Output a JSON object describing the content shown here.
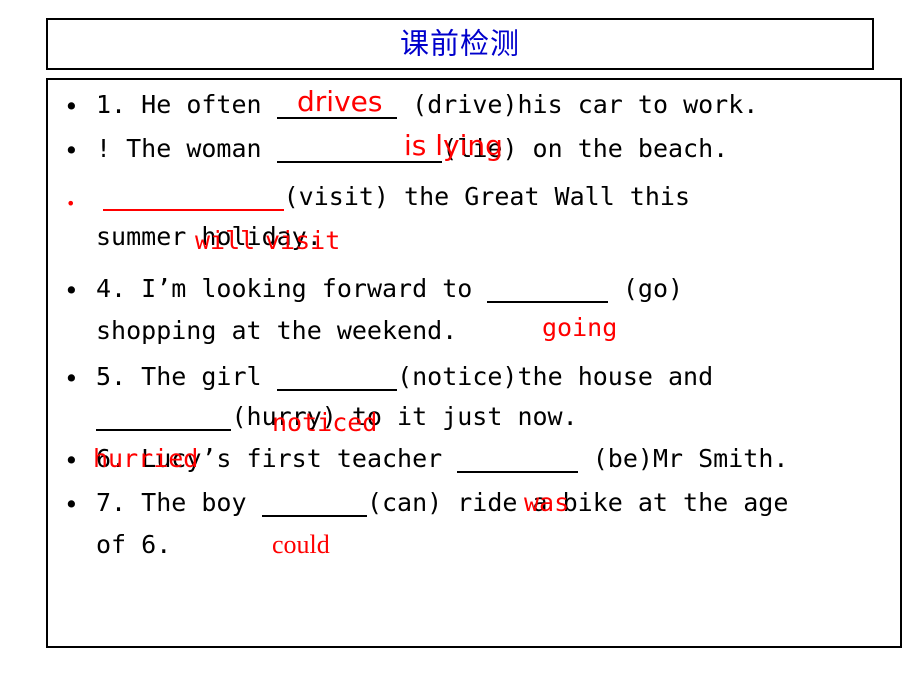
{
  "slide": {
    "title": "课前检测",
    "title_color": "#0000cc",
    "answer_color": "#ff0000",
    "text_color": "#000000",
    "background": "#ffffff"
  },
  "questions": [
    {
      "bullet": "•",
      "bullet_color": "#000000",
      "number": "1.",
      "segments_line1": {
        "before": "He often",
        "blank": "______",
        "after": "(drive)his car to work."
      },
      "segments_line2": null
    },
    {
      "bullet": "•",
      "bullet_color": "#000000",
      "number": "!",
      "segments_line1": {
        "before": "The woman",
        "blank": "__________",
        "after": "(lie) on the beach."
      },
      "segments_line2": null
    },
    {
      "bullet": "•",
      "bullet_color": "#ff0000",
      "number": "",
      "segments_line1": {
        "before": "",
        "blank": "___________",
        "after": "(visit) the Great Wall this"
      },
      "segments_line2": {
        "text": "summer holiday."
      }
    },
    {
      "bullet": "•",
      "bullet_color": "#000000",
      "number": "4.",
      "segments_line1": {
        "before": "I’m looking forward to",
        "blank": "______",
        "after": "(go)"
      },
      "segments_line2": {
        "text": "shopping at the weekend."
      }
    },
    {
      "bullet": "•",
      "bullet_color": "#000000",
      "number": "5.",
      "segments_line1": {
        "before": "The girl",
        "blank": "_______",
        "after": "(notice)the house and"
      },
      "segments_line2": {
        "blank": "________",
        "text": "(hurry) to it just now."
      }
    },
    {
      "bullet": "•",
      "bullet_color": "#000000",
      "number": "6.",
      "segments_line1": {
        "before": "Lucy’s first teacher",
        "blank": "_______",
        "after": "(be)Mr Smith."
      },
      "segments_line2": null
    },
    {
      "bullet": "•",
      "bullet_color": "#000000",
      "number": "7.",
      "segments_line1": {
        "before": "The boy",
        "blank": "______",
        "after": "(can) ride a bike at the age"
      },
      "segments_line2": {
        "text": "of 6."
      }
    }
  ],
  "answers": [
    {
      "text": "drives",
      "style": "sans"
    },
    {
      "text": "is lying",
      "style": "sans"
    },
    {
      "text": "will",
      "style": "mono"
    },
    {
      "text": "visit",
      "style": "mono"
    },
    {
      "text": "going",
      "style": "mono"
    },
    {
      "text": "noticed",
      "style": "mono"
    },
    {
      "text": "hurried",
      "style": "mono"
    },
    {
      "text": "was",
      "style": "mono"
    },
    {
      "text": "could",
      "style": "serif"
    }
  ]
}
